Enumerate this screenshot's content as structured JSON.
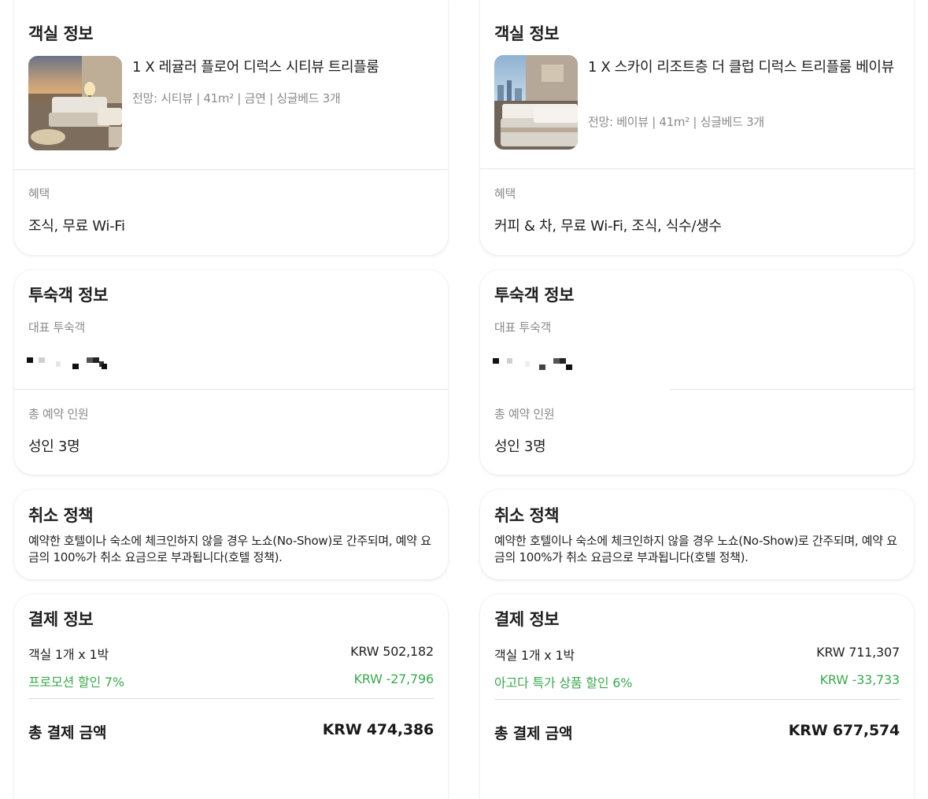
{
  "colors": {
    "discount_green": "#3ca84f",
    "muted_gray": "#8a8a8a",
    "text_dark": "#1f1f1f"
  },
  "left": {
    "room": {
      "title": "객실 정보",
      "name": "1 X 레귤러 플로어 디럭스 시티뷰 트리플룸",
      "meta": "전망: 시티뷰 | 41m² | 금연 | 싱글베드 3개",
      "benefit_label": "혜택",
      "benefits": "조식, 무료 Wi-Fi"
    },
    "guest": {
      "title": "투숙객 정보",
      "lead_label": "대표 투숙객",
      "total_label": "총 예약 인원",
      "total_value": "성인 3명"
    },
    "cancel": {
      "title": "취소 정책",
      "text": "예약한 호텔이나 숙소에 체크인하지 않을 경우 노쇼(No-Show)로 간주되며, 예약 요금의 100%가 취소 요금으로 부과됩니다(호텔 정책)."
    },
    "payment": {
      "title": "결제 정보",
      "room_label": "객실 1개 x 1박",
      "room_amount": "KRW 502,182",
      "discount_label": "프로모션 할인 7%",
      "discount_amount": "KRW -27,796",
      "total_label": "총 결제 금액",
      "total_amount": "KRW 474,386"
    }
  },
  "right": {
    "room": {
      "title": "객실 정보",
      "name": "1 X 스카이 리조트층 더 클럽 디럭스 트리플룸 베이뷰",
      "meta": "전망: 베이뷰 | 41m² | 싱글베드 3개",
      "benefit_label": "혜택",
      "benefits": "커피 & 차, 무료 Wi-Fi, 조식, 식수/생수"
    },
    "guest": {
      "title": "투숙객 정보",
      "lead_label": "대표 투숙객",
      "total_label": "총 예약 인원",
      "total_value": "성인 3명"
    },
    "cancel": {
      "title": "취소 정책",
      "text": "예약한 호텔이나 숙소에 체크인하지 않을 경우 노쇼(No-Show)로 간주되며, 예약 요금의 100%가 취소 요금으로 부과됩니다(호텔 정책)."
    },
    "payment": {
      "title": "결제 정보",
      "room_label": "객실 1개 x 1박",
      "room_amount": "KRW 711,307",
      "discount_label": "아고다 특가 상품 할인 6%",
      "discount_amount": "KRW -33,733",
      "total_label": "총 결제 금액",
      "total_amount": "KRW 677,574"
    }
  }
}
